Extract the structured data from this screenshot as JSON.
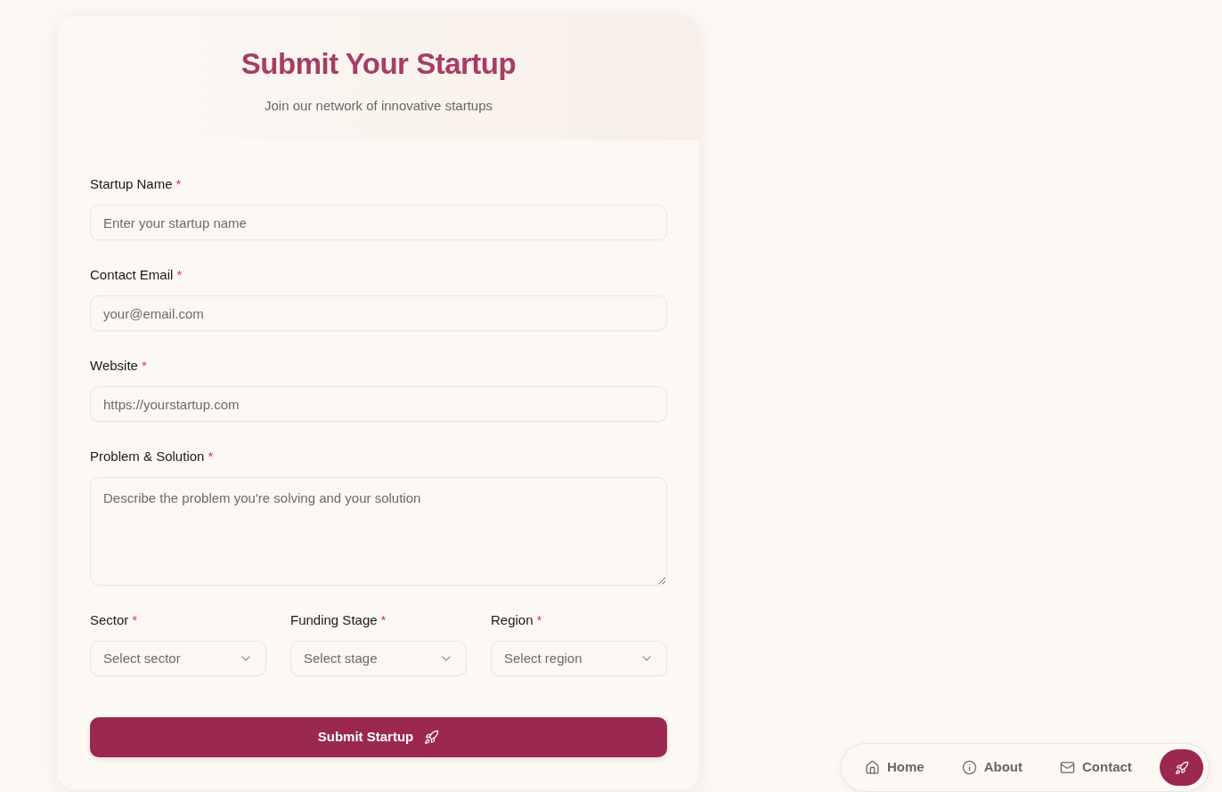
{
  "header": {
    "title": "Submit Your Startup",
    "subtitle": "Join our network of innovative startups"
  },
  "form": {
    "fields": [
      {
        "kind": "input",
        "label": "Startup Name",
        "required_mark": "*",
        "placeholder": "Enter your startup name"
      },
      {
        "kind": "input",
        "label": "Contact Email",
        "required_mark": "*",
        "placeholder": "your@email.com"
      },
      {
        "kind": "input",
        "label": "Website",
        "required_mark": "*",
        "placeholder": "https://yourstartup.com"
      },
      {
        "kind": "textarea",
        "label": "Problem & Solution",
        "required_mark": "*",
        "placeholder": "Describe the problem you're solving and your solution"
      }
    ],
    "selects": [
      {
        "label": "Sector",
        "required_mark": "*",
        "placeholder": "Select sector"
      },
      {
        "label": "Funding Stage",
        "required_mark": "*",
        "placeholder": "Select stage"
      },
      {
        "label": "Region",
        "required_mark": "*",
        "placeholder": "Select region"
      }
    ],
    "submit": {
      "label": "Submit Startup"
    }
  },
  "nav": {
    "links": [
      {
        "label": "Home"
      },
      {
        "label": "About"
      },
      {
        "label": "Contact"
      }
    ]
  }
}
